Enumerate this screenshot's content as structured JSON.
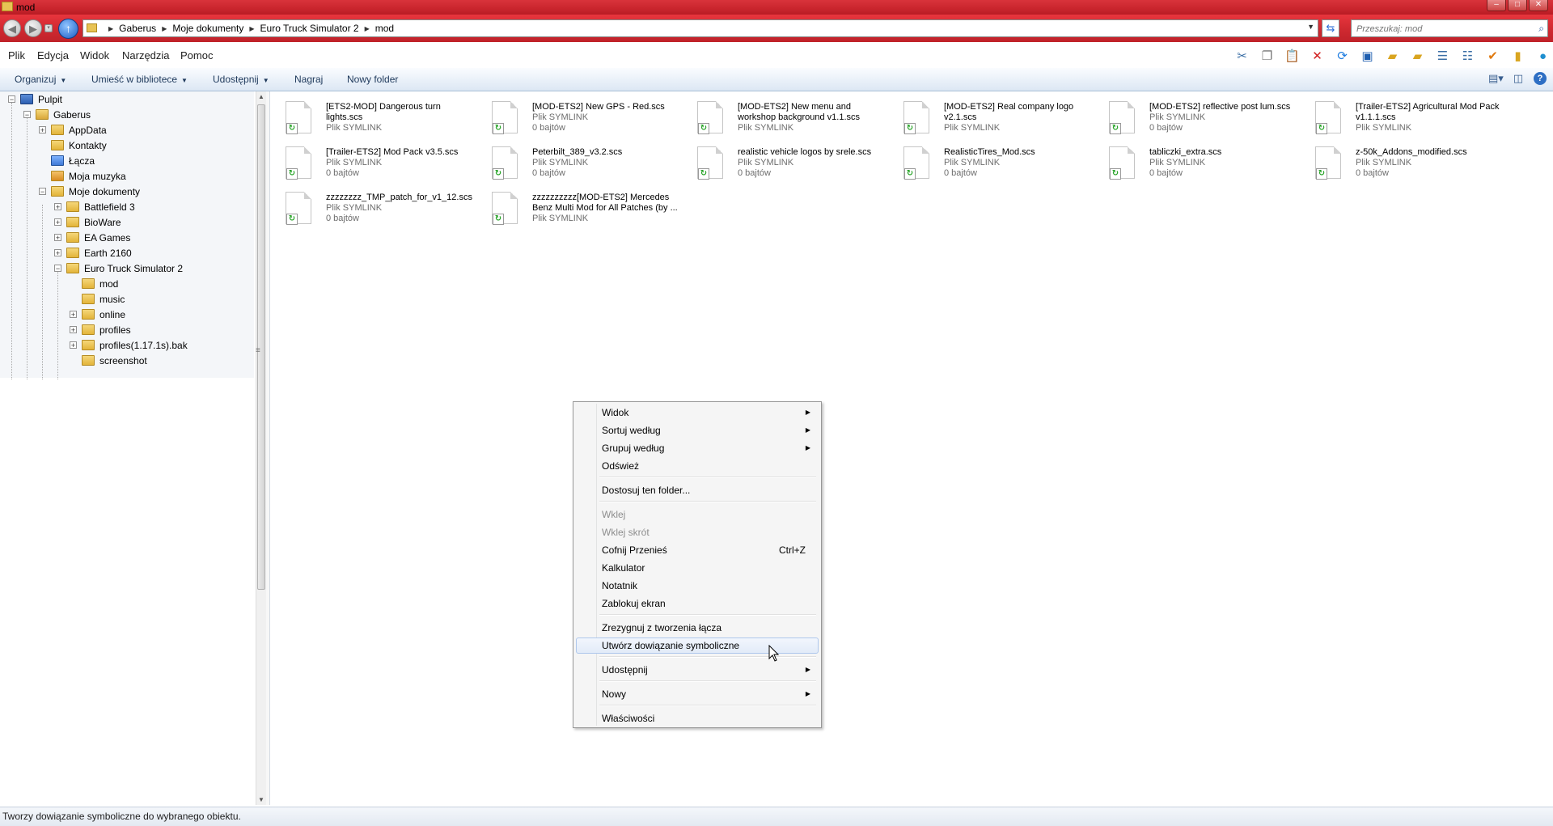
{
  "window": {
    "title": "mod"
  },
  "address": {
    "breadcrumbs": [
      "Gaberus",
      "Moje dokumenty",
      "Euro Truck Simulator 2",
      "mod"
    ],
    "search_placeholder": "Przeszukaj: mod"
  },
  "menubar": {
    "items": [
      "Plik",
      "Edycja",
      "Widok",
      "Narzędzia",
      "Pomoc"
    ]
  },
  "toolbar_icons": [
    "scissors-icon",
    "copy-icon",
    "paste-icon",
    "delete-icon",
    "refresh-icon",
    "properties-icon",
    "move-icon",
    "copy-to-icon",
    "details-icon",
    "list-icon",
    "checkmark-icon",
    "folder-options-icon",
    "globe-icon"
  ],
  "commandbar": {
    "organize": "Organizuj",
    "library": "Umieść w bibliotece",
    "share": "Udostępnij",
    "burn": "Nagraj",
    "new_folder": "Nowy folder"
  },
  "tree": {
    "items": [
      {
        "label": "Pulpit",
        "level": 0,
        "expander": "−",
        "icon": "desktop"
      },
      {
        "label": "Gaberus",
        "level": 1,
        "expander": "−",
        "icon": "user"
      },
      {
        "label": "AppData",
        "level": 2,
        "expander": "+",
        "icon": "folder"
      },
      {
        "label": "Kontakty",
        "level": 2,
        "expander": "",
        "icon": "folder"
      },
      {
        "label": "Łącza",
        "level": 2,
        "expander": "",
        "icon": "links"
      },
      {
        "label": "Moja muzyka",
        "level": 2,
        "expander": "",
        "icon": "music"
      },
      {
        "label": "Moje dokumenty",
        "level": 2,
        "expander": "−",
        "icon": "folder"
      },
      {
        "label": "Battlefield 3",
        "level": 3,
        "expander": "+",
        "icon": "folder"
      },
      {
        "label": "BioWare",
        "level": 3,
        "expander": "+",
        "icon": "folder"
      },
      {
        "label": "EA Games",
        "level": 3,
        "expander": "+",
        "icon": "folder"
      },
      {
        "label": "Earth 2160",
        "level": 3,
        "expander": "+",
        "icon": "folder"
      },
      {
        "label": "Euro Truck Simulator 2",
        "level": 3,
        "expander": "−",
        "icon": "folder"
      },
      {
        "label": "mod",
        "level": 4,
        "expander": "",
        "icon": "folder"
      },
      {
        "label": "music",
        "level": 4,
        "expander": "",
        "icon": "folder"
      },
      {
        "label": "online",
        "level": 4,
        "expander": "+",
        "icon": "folder"
      },
      {
        "label": "profiles",
        "level": 4,
        "expander": "+",
        "icon": "folder"
      },
      {
        "label": "profiles(1.17.1s).bak",
        "level": 4,
        "expander": "+",
        "icon": "folder"
      },
      {
        "label": "screenshot",
        "level": 4,
        "expander": "",
        "icon": "folder"
      }
    ]
  },
  "files": [
    {
      "name": "[ETS2-MOD] Dangerous turn lights.scs",
      "type": "Plik SYMLINK",
      "size": ""
    },
    {
      "name": "[MOD-ETS2] New GPS - Red.scs",
      "type": "Plik SYMLINK",
      "size": "0 bajtów"
    },
    {
      "name": "[MOD-ETS2] New menu and workshop background v1.1.scs",
      "type": "Plik SYMLINK",
      "size": ""
    },
    {
      "name": "[MOD-ETS2] Real company logo v2.1.scs",
      "type": "Plik SYMLINK",
      "size": ""
    },
    {
      "name": "[MOD-ETS2] reflective post lum.scs",
      "type": "Plik SYMLINK",
      "size": "0 bajtów"
    },
    {
      "name": "[Trailer-ETS2] Agricultural Mod Pack v1.1.1.scs",
      "type": "Plik SYMLINK",
      "size": ""
    },
    {
      "name": "[Trailer-ETS2] Mod Pack v3.5.scs",
      "type": "Plik SYMLINK",
      "size": "0 bajtów"
    },
    {
      "name": "Peterbilt_389_v3.2.scs",
      "type": "Plik SYMLINK",
      "size": "0 bajtów"
    },
    {
      "name": "realistic vehicle logos by srele.scs",
      "type": "Plik SYMLINK",
      "size": "0 bajtów"
    },
    {
      "name": "RealisticTires_Mod.scs",
      "type": "Plik SYMLINK",
      "size": "0 bajtów"
    },
    {
      "name": "tabliczki_extra.scs",
      "type": "Plik SYMLINK",
      "size": "0 bajtów"
    },
    {
      "name": "z-50k_Addons_modified.scs",
      "type": "Plik SYMLINK",
      "size": "0 bajtów"
    },
    {
      "name": "zzzzzzzz_TMP_patch_for_v1_12.scs",
      "type": "Plik SYMLINK",
      "size": "0 bajtów"
    },
    {
      "name": "zzzzzzzzzz[MOD-ETS2] Mercedes Benz Multi Mod for All Patches (by ...",
      "type": "Plik SYMLINK",
      "size": ""
    }
  ],
  "context_menu": {
    "items": [
      {
        "label": "Widok",
        "submenu": true
      },
      {
        "label": "Sortuj według",
        "submenu": true
      },
      {
        "label": "Grupuj według",
        "submenu": true
      },
      {
        "label": "Odśwież"
      },
      {
        "separator": true
      },
      {
        "label": "Dostosuj ten folder..."
      },
      {
        "separator": true
      },
      {
        "label": "Wklej",
        "disabled": true
      },
      {
        "label": "Wklej skrót",
        "disabled": true
      },
      {
        "label": "Cofnij Przenieś",
        "shortcut": "Ctrl+Z"
      },
      {
        "label": "Kalkulator"
      },
      {
        "label": "Notatnik"
      },
      {
        "label": "Zablokuj ekran"
      },
      {
        "separator": true
      },
      {
        "label": "Zrezygnuj z tworzenia łącza"
      },
      {
        "label": "Utwórz dowiązanie symboliczne",
        "highlighted": true
      },
      {
        "separator": true
      },
      {
        "label": "Udostępnij",
        "submenu": true
      },
      {
        "separator": true
      },
      {
        "label": "Nowy",
        "submenu": true
      },
      {
        "separator": true
      },
      {
        "label": "Właściwości"
      }
    ]
  },
  "statusbar": {
    "text": "Tworzy dowiązanie symboliczne do wybranego obiektu."
  }
}
